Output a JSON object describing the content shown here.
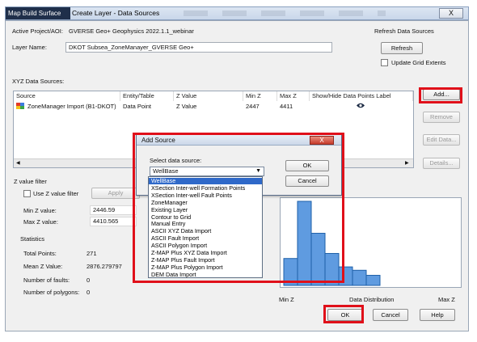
{
  "titlebar": {
    "app_label": "Map Build Surface",
    "title": "Create Layer - Data Sources",
    "close_label": "X"
  },
  "project": {
    "active_label": "Active Project/AOI:",
    "active_value": "GVERSE Geo+  Geophysics 2022.1.1_webinar",
    "layer_label": "Layer Name:",
    "layer_value": "DKOT Subsea_ZoneManayer_GVERSE Geo+"
  },
  "refresh": {
    "group_label": "Refresh Data Sources",
    "button_label": "Refresh",
    "update_grid_label": "Update Grid Extents"
  },
  "xyz": {
    "section_label": "XYZ Data Sources:",
    "columns": [
      "Source",
      "Entity/Table",
      "Z Value",
      "Min Z",
      "Max Z",
      "Show/Hide Data Points Label"
    ],
    "rows": [
      {
        "source": "ZoneManager Import (B1-DKOT)",
        "entity": "Data Point",
        "zvalue": "Z Value",
        "minz": "2447",
        "maxz": "4411"
      }
    ]
  },
  "side_buttons": {
    "add": "Add...",
    "remove": "Remove",
    "edit": "Edit Data...",
    "details": "Details..."
  },
  "zfilter": {
    "section_label": "Z value filter",
    "use_label": "Use Z value filter",
    "apply_label": "Apply",
    "min_label": "Min Z value:",
    "min_value": "2446.59",
    "max_label": "Max Z value:",
    "max_value": "4410.565"
  },
  "statistics": {
    "section_label": "Statistics",
    "total_points_label": "Total Points:",
    "total_points_value": "271",
    "mean_label": "Mean Z Value:",
    "mean_value": "2876.279797",
    "faults_label": "Number of faults:",
    "faults_value": "0",
    "polygons_label": "Number of polygons:",
    "polygons_value": "0"
  },
  "histogram": {
    "min_label": "Min Z",
    "center_label": "Data Distribution",
    "max_label": "Max Z",
    "bars": [
      0.32,
      1.0,
      0.62,
      0.38,
      0.22,
      0.18,
      0.12
    ]
  },
  "footer": {
    "ok_label": "OK",
    "cancel_label": "Cancel",
    "help_label": "Help"
  },
  "dialog": {
    "title": "Add Source",
    "close_label": "X",
    "select_label": "Select data source:",
    "selected_value": "WellBase",
    "ok_label": "OK",
    "cancel_label": "Cancel",
    "options": [
      "WellBase",
      "XSection Inter-well Formation Points",
      "XSection Inter-well Fault Points",
      "ZoneManager",
      "Existing Layer",
      "Contour to Grid",
      "Manual Entry",
      "ASCII XYZ Data Import",
      "ASCII Fault Import",
      "ASCII Polygon Import",
      "Z-MAP Plus XYZ Data Import",
      "Z-MAP Plus Fault Import",
      "Z-MAP Plus Polygon Import",
      "DEM Data Import"
    ]
  },
  "colors": {
    "highlight": "#e0101a",
    "selection": "#2f69c9",
    "histogram_bar": "#5f9be0"
  }
}
